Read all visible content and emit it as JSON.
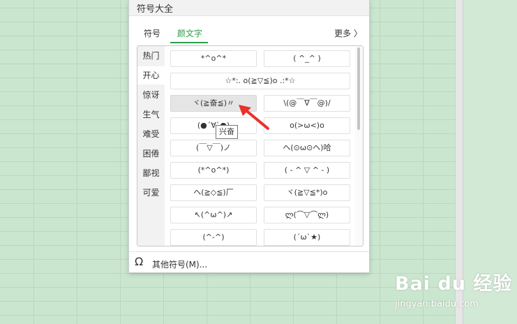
{
  "panel": {
    "title": "符号大全",
    "tabs": [
      "符号",
      "颜文字"
    ],
    "active_tab": "颜文字",
    "more": "更多 〉",
    "categories": [
      "热门",
      "开心",
      "惊讶",
      "生气",
      "难受",
      "困倦",
      "鄙视",
      "可爱"
    ],
    "selected_category": "开心",
    "emoticons": [
      "*^o^*",
      "( ^_^ )",
      "☆*:. o(≧▽≦)o .:*☆",
      "ヾ(≧奋≦)〃",
      "\\(@￣∇￣@)/",
      "(●´∀`●)",
      "o(>ω<)o",
      "(￣▽￣)ノ",
      "ヘ(⊙ω⊙ヘ)哈",
      "(*^o^*)",
      "( - ^ ▽ ^ - )",
      "ヘ(≧◇≦)厂",
      "ヾ(≧▽≦*)o",
      "↖(^ω^)↗",
      "ლ(⌒▽⌒ლ)",
      "(^-^)",
      "(´ω`★)"
    ],
    "tooltip": "兴奋",
    "other_symbols": "其他符号(M)...",
    "omega_icon": "Ω"
  },
  "watermark": {
    "brand": "Bai du 经验",
    "url": "jingyan.baidu.com"
  },
  "colors": {
    "accent": "#2e9b4a",
    "sheet_bg": "#cbe6cf",
    "arrow": "#e8322a"
  }
}
